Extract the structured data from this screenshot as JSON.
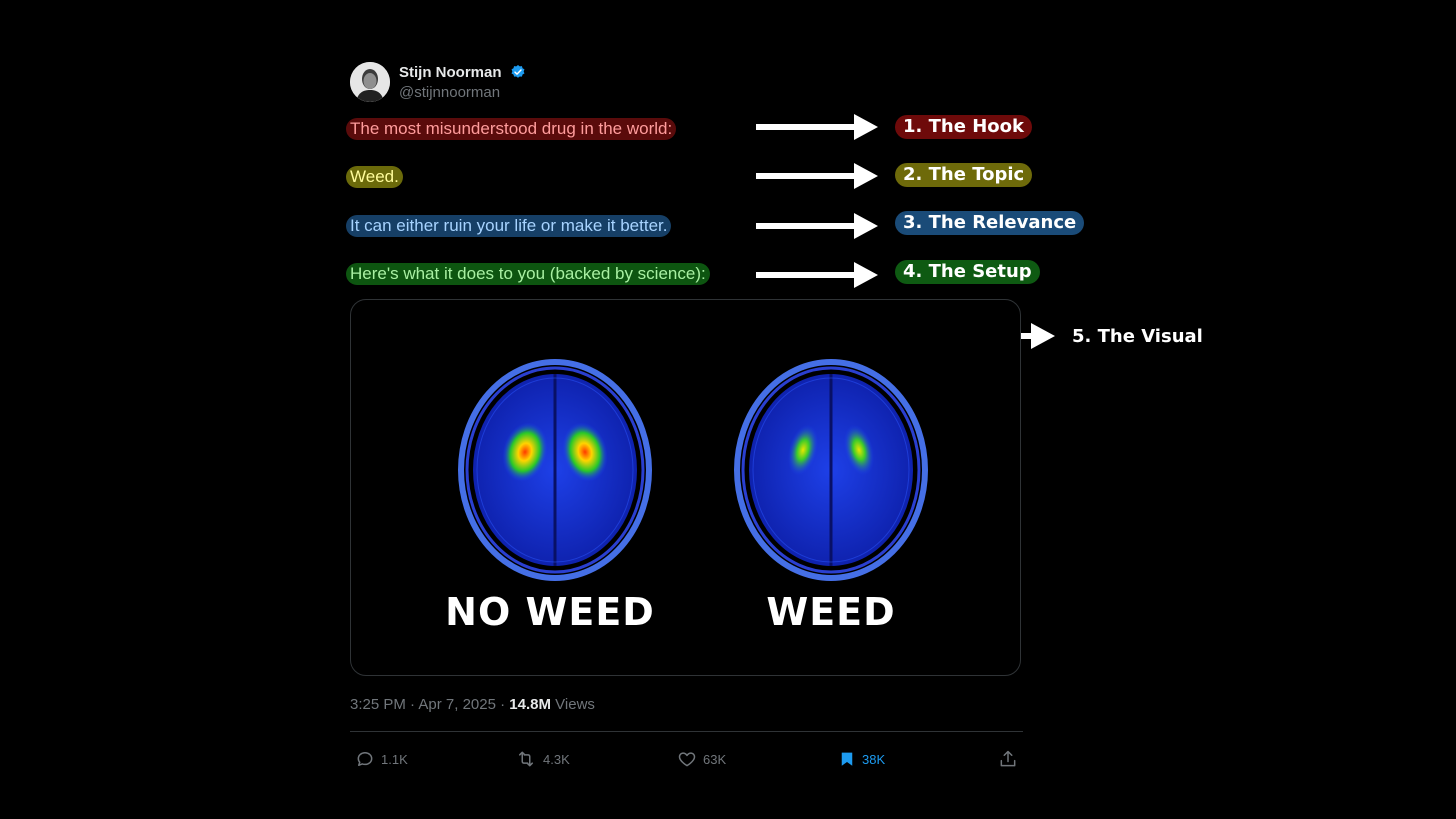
{
  "author": {
    "name": "Stijn Noorman",
    "handle": "@stijnnoorman"
  },
  "tweet_lines": [
    {
      "text": "The most misunderstood drug in the world:",
      "highlight": "#5a0b0b"
    },
    {
      "text": "Weed.",
      "highlight": "#6b6a0a"
    },
    {
      "text": "It can either ruin your life or make it better.",
      "highlight": "#163f66"
    },
    {
      "text": "Here's what it does to you (backed by science):",
      "highlight": "#0d5510"
    }
  ],
  "annotations": [
    {
      "label": "1. The Hook",
      "color": "#6e0a0a"
    },
    {
      "label": "2. The Topic",
      "color": "#6e6a0a"
    },
    {
      "label": "3. The Relevance",
      "color": "#1a4b78"
    },
    {
      "label": "4. The Setup",
      "color": "#0e5a12"
    },
    {
      "label": "5. The Visual",
      "color": "none"
    }
  ],
  "media": {
    "left_caption": "NO WEED",
    "right_caption": "WEED"
  },
  "meta": {
    "time": "3:25 PM",
    "separator": "·",
    "date": "Apr 7, 2025",
    "views_count": "14.8M",
    "views_label": "Views"
  },
  "actions": {
    "replies": "1.1K",
    "reposts": "4.3K",
    "likes": "63K",
    "bookmarks": "38K"
  },
  "colors": {
    "accent": "#1d9bf0",
    "muted": "#71767b"
  }
}
